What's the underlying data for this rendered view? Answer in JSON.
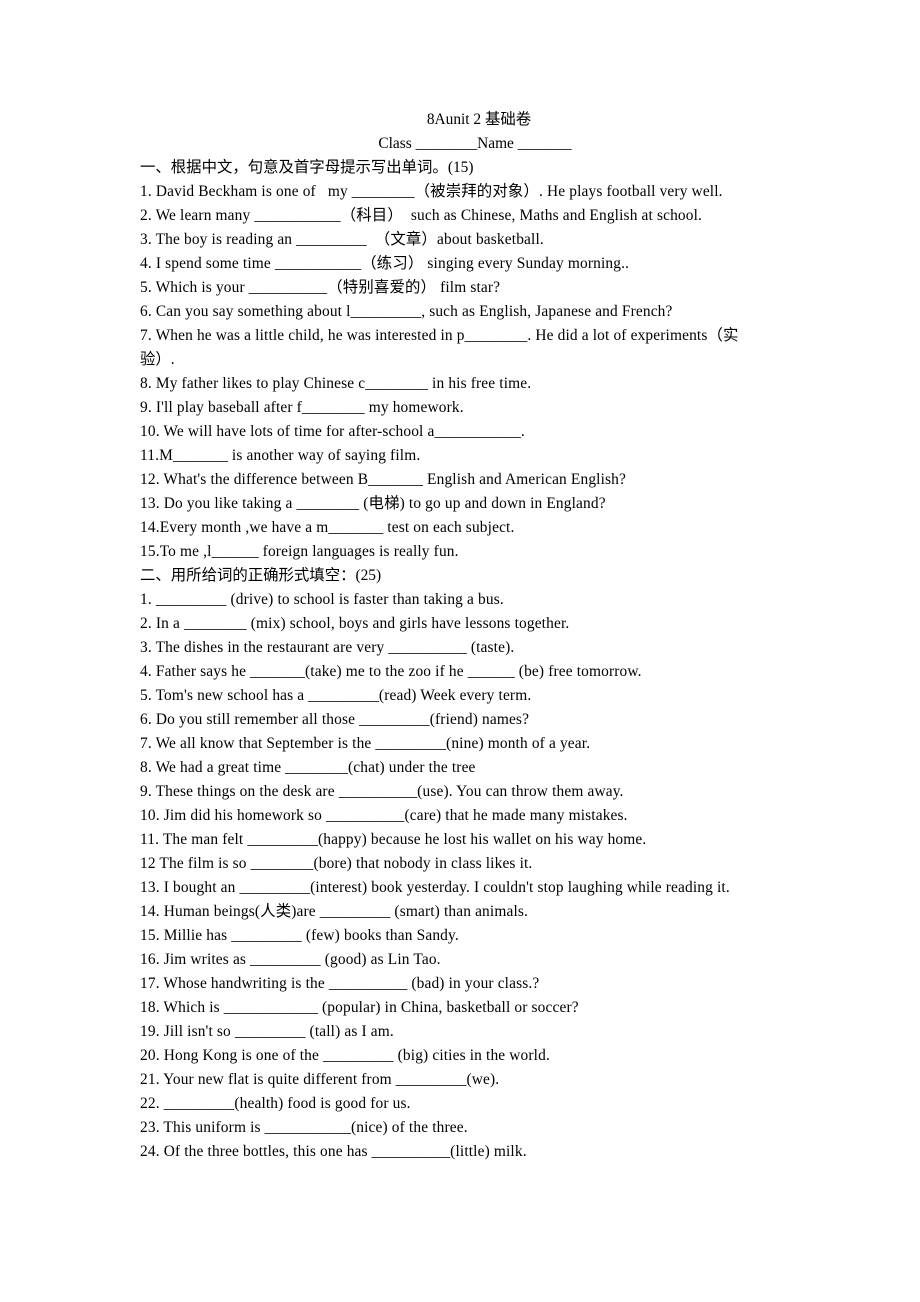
{
  "document": {
    "title": "8Aunit 2  基础卷",
    "name_line": "Class ________Name _______",
    "section_one": {
      "heading": "一、根据中文，句意及首字母提示写出单词。(15)",
      "items": [
        "1. David Beckham is one of   my ________（被崇拜的对象）. He plays football very well.",
        "2. We learn many ___________（科目）  such as Chinese, Maths and English at school.",
        "3. The boy is reading an _________  （文章）about basketball.",
        "4. I spend some time ___________（练习） singing every Sunday morning..",
        "5. Which is your __________（特别喜爱的） film star?",
        "6. Can you say something about l_________, such as English, Japanese and French?",
        "7. When he was a little child, he was interested in p________. He did a lot of experiments（实",
        "验）.",
        "8. My father likes to play Chinese c________ in his free time.",
        "9. I'll play baseball after f________ my homework.",
        "10. We will have lots of time for after-school a___________.",
        "11.M_______ is another way of saying film.",
        "12. What's the difference between B_______ English and American English?",
        "13. Do you like taking a ________ (电梯) to go up and down in England?",
        "14.Every month ,we have a m_______ test on each subject.",
        "15.To me ,l______ foreign languages is really fun."
      ]
    },
    "section_two": {
      "heading": "二、用所给词的正确形式填空：(25)",
      "items": [
        "1. _________ (drive) to school is faster than taking a bus.",
        "2. In a ________ (mix) school, boys and girls have lessons together.",
        "3. The dishes in the restaurant are very __________ (taste).",
        "4. Father says he _______(take) me to the zoo if he ______ (be) free tomorrow.",
        "5. Tom's new school has a _________(read) Week every term.",
        "6. Do you still remember all those _________(friend) names?",
        "7. We all know that September is the _________(nine) month of a year.",
        "8. We had a great time ________(chat) under the tree",
        "9. These things on the desk are __________(use). You can throw them away.",
        "10. Jim did his homework so __________(care) that he made many mistakes.",
        "11. The man felt _________(happy) because he lost his wallet on his way home.",
        "12 The film is so ________(bore) that nobody in class likes it.",
        "13. I bought an _________(interest) book yesterday. I couldn't stop laughing while reading it.",
        "14. Human beings(人类)are _________ (smart) than animals.",
        "15. Millie has _________ (few) books than Sandy.",
        "16. Jim writes as _________ (good) as Lin Tao.",
        "17. Whose handwriting is the __________ (bad) in your class.?",
        "18. Which is ____________ (popular) in China, basketball or soccer?",
        "19. Jill isn't so _________ (tall) as I am.",
        "20. Hong Kong is one of the _________ (big) cities in the world.",
        "21. Your new flat is quite different from _________(we).",
        "22. _________(health) food is good for us.",
        "23. This uniform is ___________(nice) of the three.",
        "24. Of the three bottles, this one has __________(little) milk."
      ]
    }
  }
}
